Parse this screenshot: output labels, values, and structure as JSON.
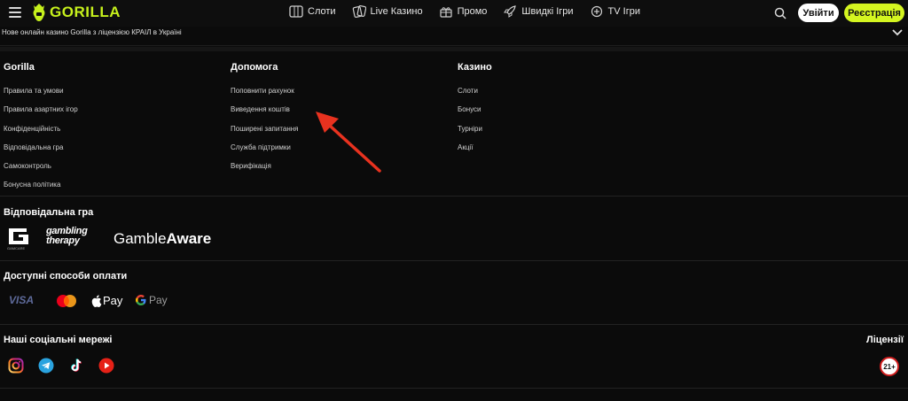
{
  "header": {
    "logo_text": "GORILLA",
    "nav": [
      {
        "label": "Слоти",
        "icon": "slots-icon"
      },
      {
        "label": "Live Казино",
        "icon": "cards-icon"
      },
      {
        "label": "Промо",
        "icon": "gift-icon"
      },
      {
        "label": "Швидкі Ігри",
        "icon": "rocket-icon"
      },
      {
        "label": "TV Ігри",
        "icon": "tv-icon"
      }
    ],
    "login_label": "Увійти",
    "register_label": "Реєстрація",
    "colors": {
      "brand": "#c6f01c",
      "register_bg": "#d4f520"
    }
  },
  "license_strip": {
    "text": "Нове онлайн казино Gorilla з ліцензією КРАІЛ в Україні"
  },
  "footer": {
    "columns": [
      {
        "title": "Gorilla",
        "links": [
          "Правила та умови",
          "Правила азартних ігор",
          "Конфіденційність",
          "Відповідальна гра",
          "Самоконтроль",
          "Бонусна політика"
        ]
      },
      {
        "title": "Допомога",
        "links": [
          "Поповнити рахунок",
          "Виведення коштів",
          "Поширені запитання",
          "Служба підтримки",
          "Верифікація"
        ]
      },
      {
        "title": "Казино",
        "links": [
          "Слоти",
          "Бонуси",
          "Турніри",
          "Акції"
        ]
      }
    ],
    "responsible_gaming": {
      "title": "Відповідальна гра",
      "logos": {
        "gamcare_sub": "GAMCARE",
        "gambling_therapy_line1": "gambling",
        "gambling_therapy_line2": "therapy",
        "gambleaware_a": "Gamble",
        "gambleaware_b": "Aware"
      }
    },
    "payments": {
      "title": "Доступні способи оплати",
      "visa": "VISA",
      "apple_pay": "Pay",
      "google_pay": "Pay"
    },
    "social": {
      "title": "Наші соціальні мережі",
      "icons": [
        "instagram-icon",
        "telegram-icon",
        "tiktok-icon",
        "youtube-icon"
      ]
    },
    "licenses": {
      "title": "Ліцензії",
      "age_badge": "21+"
    }
  },
  "annotation": {
    "arrow_color": "#e8321f"
  }
}
